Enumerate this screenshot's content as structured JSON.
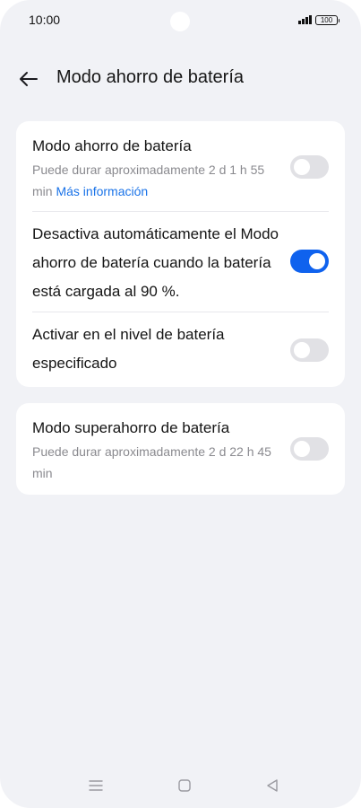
{
  "status_bar": {
    "time": "10:00",
    "battery_level": "100",
    "icons": [
      "signal-icon",
      "battery-icon"
    ]
  },
  "header": {
    "back_icon": "arrow-left-icon",
    "title": "Modo ahorro de batería"
  },
  "card_main": {
    "battery_saver": {
      "title": "Modo ahorro de batería",
      "subtitle": "Puede durar aproximadamente 2 d 1 h 55 min",
      "link": "Más información",
      "enabled": false
    },
    "auto_disable": {
      "title": "Desactiva automáticamente el Modo ahorro de batería cuando la batería está cargada al 90 %.",
      "enabled": true
    },
    "activate_at_level": {
      "title": "Activar en el nivel de batería especificado",
      "enabled": false
    }
  },
  "card_super": {
    "super_saver": {
      "title": "Modo superahorro de batería",
      "subtitle": "Puede durar aproximadamente 2 d 22 h 45 min",
      "enabled": false
    }
  },
  "nav_bar": {
    "icons": [
      "menu-icon",
      "home-icon",
      "back-triangle-icon"
    ]
  },
  "colors": {
    "background": "#f1f2f6",
    "card": "#ffffff",
    "accent": "#0f62ee",
    "link": "#1a73e8",
    "toggle_off": "#e1e1e5",
    "subtext": "#8a8a8f"
  }
}
